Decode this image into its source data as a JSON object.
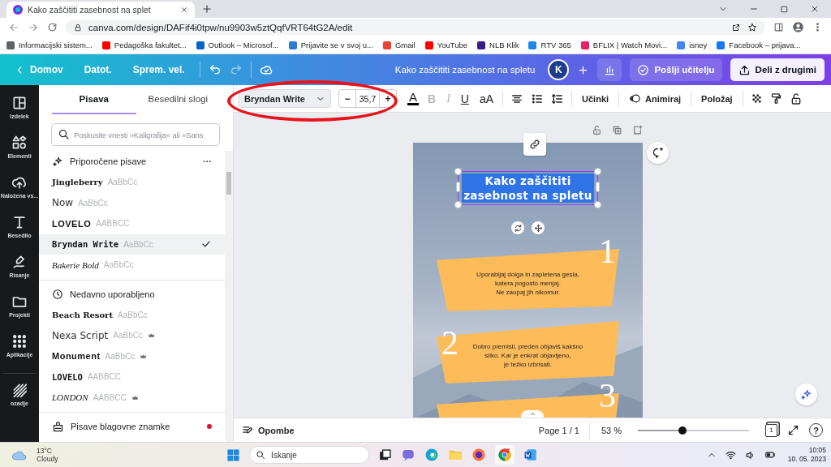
{
  "browser": {
    "tab_title": "Kako zaščititi zasebnost na splet",
    "url": "canva.com/design/DAFif4i0tpw/nu9903w5ztQqfVRT64tG2A/edit",
    "bookmarks": [
      {
        "label": "Informacijski sistem...",
        "color": "#5f6368"
      },
      {
        "label": "Pedagoška fakultet...",
        "color": "#ff0000"
      },
      {
        "label": "Outlook – Microsof...",
        "color": "#0a64c8"
      },
      {
        "label": "Prijavite se v svoj u...",
        "color": "#2a7bd6"
      },
      {
        "label": "Gmail",
        "color": "#ea4335"
      },
      {
        "label": "YouTube",
        "color": "#ff0000"
      },
      {
        "label": "NLB Klik",
        "color": "#3b1a8c"
      },
      {
        "label": "RTV 365",
        "color": "#1e88e5"
      },
      {
        "label": "BFLIX | Watch Movi...",
        "color": "#e91e63"
      },
      {
        "label": "isney",
        "color": "#4285f4"
      },
      {
        "label": "Facebook – prijava...",
        "color": "#1877f2"
      }
    ]
  },
  "header": {
    "back": "Domov",
    "menu": [
      "Datot.",
      "Sprem. vel."
    ],
    "title": "Kako zaščititi zasebnost na spletu",
    "avatar": "K",
    "send": "Pošlji učitelju",
    "share": "Deli z drugimi"
  },
  "sidebar": [
    {
      "label": "Izdelek"
    },
    {
      "label": "Elementi"
    },
    {
      "label": "Naložena vs..."
    },
    {
      "label": "Besedilo"
    },
    {
      "label": "Risanje"
    },
    {
      "label": "Projekti"
    },
    {
      "label": "Aplikacije"
    },
    {
      "label": "ozadje"
    }
  ],
  "panel": {
    "tabs": [
      {
        "label": "Pisava",
        "selected": true
      },
      {
        "label": "Besedilni slogi",
        "selected": false
      }
    ],
    "search": {
      "placeholder": "Poskusite vnesti »Kaligrafija« ali »Sans"
    },
    "sections": [
      {
        "title": "Priporočene pisave",
        "more": "···",
        "fonts": [
          {
            "name": "Jingleberry",
            "sample": "AaBbCc",
            "selected": false,
            "premium": false
          },
          {
            "name": "Now",
            "sample": "AaBbCc",
            "selected": false,
            "premium": false
          },
          {
            "name": "LOVELO",
            "sample": "AABBCC",
            "selected": false,
            "premium": false
          },
          {
            "name": "Bryndan Write",
            "sample": "AaBbCc",
            "selected": true,
            "premium": false
          },
          {
            "name": "Bakerie Bold",
            "sample": "AaBbCc",
            "selected": false,
            "premium": false
          }
        ]
      },
      {
        "title": "Nedavno uporabljeno",
        "fonts": [
          {
            "name": "Beach Resort",
            "sample": "AaBbCc",
            "selected": false,
            "premium": false
          },
          {
            "name": "Nexa Script",
            "sample": "AaBbCc",
            "selected": false,
            "premium": true
          },
          {
            "name": "Monument",
            "sample": "AaBbCc",
            "selected": false,
            "premium": true
          },
          {
            "name": "LOVELO",
            "sample": "AABBCC",
            "selected": false,
            "premium": false
          },
          {
            "name": "LONDON",
            "sample": "AABBCC",
            "selected": false,
            "premium": true
          }
        ]
      }
    ],
    "brand": {
      "title": "Pisave blagovne znamke",
      "notification": true
    }
  },
  "toolbar": {
    "font": "Bryndan Write",
    "decrease": "−",
    "size": "35,7",
    "increase": "+",
    "text_color": "A",
    "format": [
      {
        "label": "B",
        "disabled": true
      },
      {
        "label": "I",
        "disabled": true
      },
      {
        "label": "U",
        "disabled": false
      },
      {
        "label": "aA",
        "disabled": false
      }
    ],
    "effects": "Učinki",
    "animate": "Animiraj",
    "position": "Položaj"
  },
  "canvas": {
    "title": "Kako zaščititi\nzasebnost na spletu",
    "title_selected": true,
    "cards": [
      {
        "number": "1",
        "text": "Uporabljaj dolga in zapletena gesla,\nkatera pogosto menjaj.\nNe zaupaj jih nikomur."
      },
      {
        "number": "2",
        "text": "Dobro premisli, preden objaviš kakšno\nsliko. Kar je enkrat objavljeno,\nje težko izbrisati."
      },
      {
        "number": "3"
      }
    ]
  },
  "bottom": {
    "notes": "Opombe",
    "page": "Page 1 / 1",
    "zoom": "53 %",
    "zoom_slider": {
      "level": 0.4
    },
    "page_count": "1",
    "help": "?"
  },
  "taskbar": {
    "temperature": "13°C",
    "weather": "Cloudy",
    "search": {
      "placeholder": "Iskanje"
    },
    "time": "10:05",
    "date": "10. 05. 2023"
  }
}
